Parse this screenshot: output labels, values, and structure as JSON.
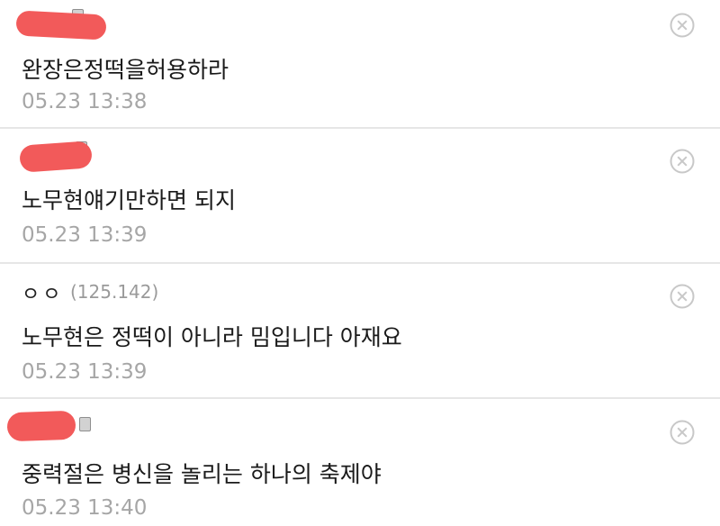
{
  "comments": [
    {
      "author_redacted": true,
      "text": "완장은정떡을허용하라",
      "time": "05.23 13:38"
    },
    {
      "author_redacted": true,
      "text": "노무현얘기만하면 되지",
      "time": "05.23 13:39"
    },
    {
      "author_redacted": false,
      "nickname": "ㅇㅇ",
      "ip": "(125.142)",
      "text": "노무현은 정떡이 아니라 밈입니다 아재요",
      "time": "05.23 13:39"
    },
    {
      "author_redacted": true,
      "text": "중력절은 병신을 놀리는 하나의 축제야",
      "time": "05.23 13:40"
    }
  ],
  "icons": {
    "delete": "close-circle-icon",
    "author_tag": "member-badge-icon"
  },
  "colors": {
    "redaction": "#f25a5a",
    "timestamp": "#a6a6a6",
    "divider": "#e6e6e6",
    "delete_icon": "#c8c8c8"
  }
}
